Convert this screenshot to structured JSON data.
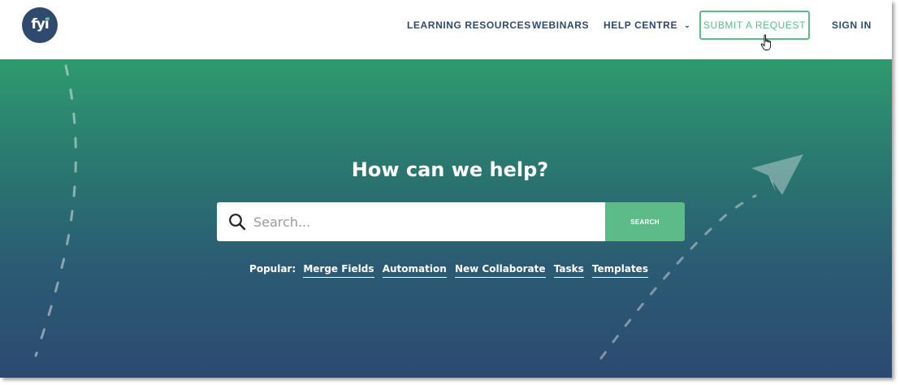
{
  "logo": {
    "text": "fyi"
  },
  "nav": {
    "items": [
      {
        "label": "LEARNING RESOURCES"
      },
      {
        "label": "WEBINARS"
      },
      {
        "label": "HELP CENTRE"
      }
    ],
    "submit_label": "SUBMIT A REQUEST",
    "signin_label": "SIGN IN"
  },
  "hero": {
    "title": "How can we help?",
    "search": {
      "placeholder": "Search...",
      "value": "",
      "button_label": "SEARCH"
    },
    "popular": {
      "label": "Popular:",
      "links": [
        "Merge Fields",
        "Automation",
        "New Collaborate",
        "Tasks",
        "Templates"
      ]
    }
  },
  "icons": {
    "logo": "fyi-logo",
    "chevron": "chevron-down-icon",
    "cursor": "hand-cursor-icon",
    "search": "search-icon",
    "paper_plane": "paper-plane-icon"
  },
  "colors": {
    "brand_navy": "#2f4a6e",
    "accent_green": "#5dbb8a",
    "hero_top": "#2e9a6f",
    "hero_bottom": "#2c4a70"
  }
}
